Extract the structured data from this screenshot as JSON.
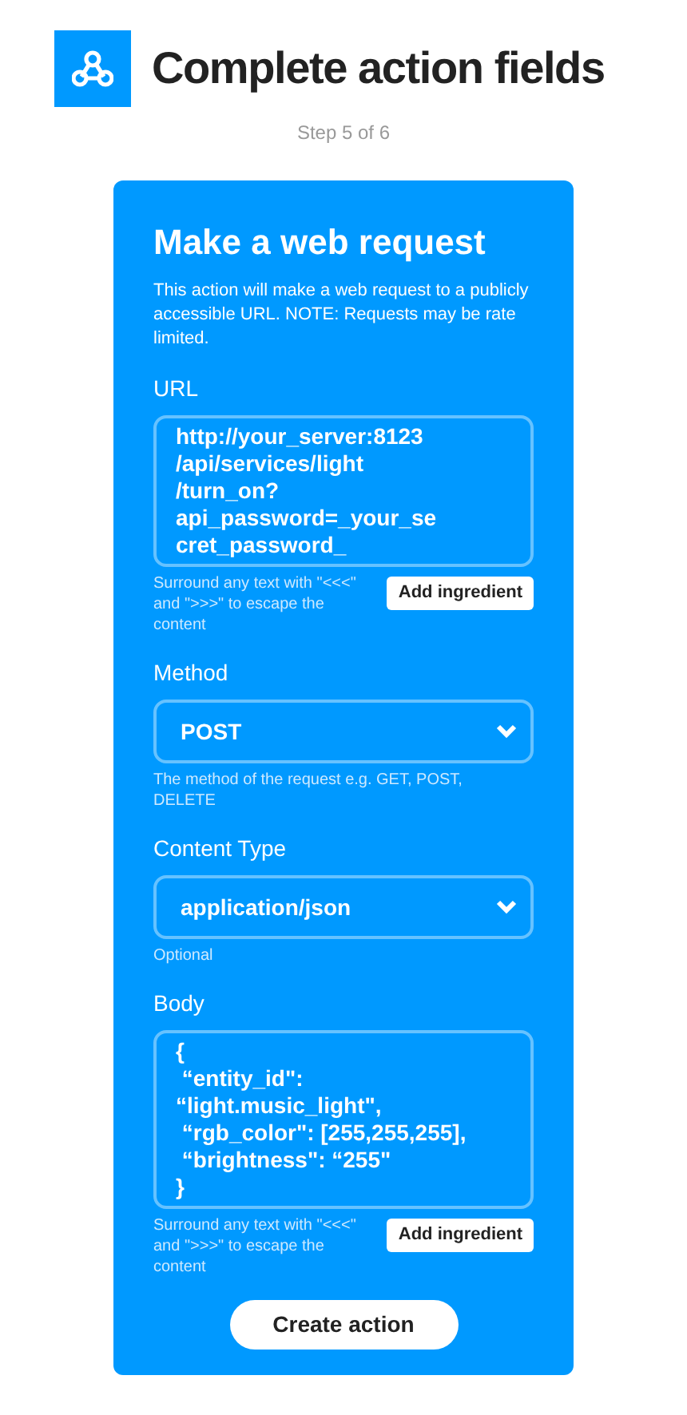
{
  "header": {
    "title": "Complete action fields",
    "step": "Step 5 of 6"
  },
  "card": {
    "title": "Make a web request",
    "description": "This action will make a web request to a publicly accessible URL. NOTE: Requests may be rate limited.",
    "fields": [
      {
        "kind": "text",
        "label": "URL",
        "value": "http://your_server:8123\n/api/services/light\n/turn_on?api_password=_your_se\ncret_password_",
        "hint": "Surround any text with \"<<<\" and \">>>\" to escape the content",
        "button": "Add ingredient"
      },
      {
        "kind": "select",
        "label": "Method",
        "value": "POST",
        "hint": "The method of the request e.g. GET, POST, DELETE"
      },
      {
        "kind": "select",
        "label": "Content Type",
        "value": "application/json",
        "hint": "Optional"
      },
      {
        "kind": "text",
        "label": "Body",
        "value": "{\n “entity_id\": “light.music_light\",\n “rgb_color\": [255,255,255],\n “brightness\": “255\"\n}",
        "hint": "Surround any text with \"<<<\" and \">>>\" to escape the content",
        "button": "Add ingredient"
      }
    ],
    "submit": "Create action"
  }
}
